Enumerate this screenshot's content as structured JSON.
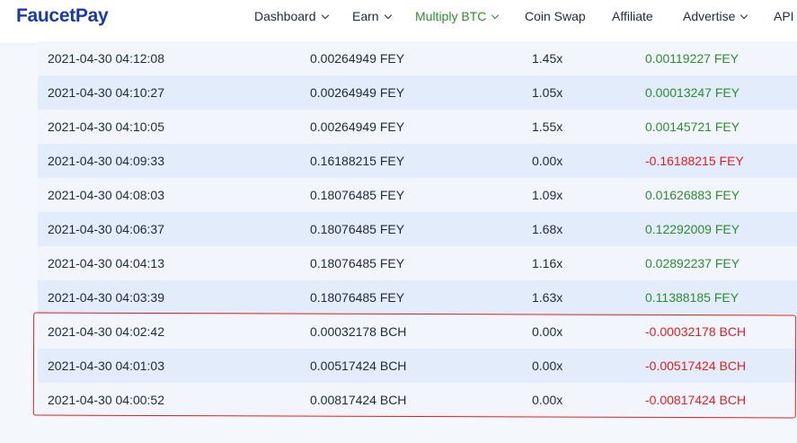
{
  "header": {
    "logo": "FaucetPay",
    "nav": [
      {
        "label": "Dashboard",
        "dropdown": true,
        "active": false
      },
      {
        "label": "Earn",
        "dropdown": true,
        "active": false
      },
      {
        "label": "Multiply BTC",
        "dropdown": true,
        "active": true
      },
      {
        "label": "Coin Swap",
        "dropdown": false,
        "active": false
      },
      {
        "label": "Affiliate",
        "dropdown": false,
        "active": false
      },
      {
        "label": "Advertise",
        "dropdown": true,
        "active": false
      },
      {
        "label": "API",
        "dropdown": false,
        "active": false
      }
    ]
  },
  "colors": {
    "brand": "#1b3aa8",
    "active_nav": "#2e8b2e",
    "profit_positive": "#2e8b2e",
    "profit_negative": "#e02020",
    "highlight_border": "#e0201e",
    "row_odd": "#f2f6fc",
    "row_even": "#e2ecfa"
  },
  "bets": [
    {
      "time": "2021-04-30 04:12:08",
      "bet": "0.00264949 FEY",
      "multiplier": "1.45x",
      "profit": "0.00119227 FEY",
      "win": true
    },
    {
      "time": "2021-04-30 04:10:27",
      "bet": "0.00264949 FEY",
      "multiplier": "1.05x",
      "profit": "0.00013247 FEY",
      "win": true
    },
    {
      "time": "2021-04-30 04:10:05",
      "bet": "0.00264949 FEY",
      "multiplier": "1.55x",
      "profit": "0.00145721 FEY",
      "win": true
    },
    {
      "time": "2021-04-30 04:09:33",
      "bet": "0.16188215 FEY",
      "multiplier": "0.00x",
      "profit": "-0.16188215 FEY",
      "win": false
    },
    {
      "time": "2021-04-30 04:08:03",
      "bet": "0.18076485 FEY",
      "multiplier": "1.09x",
      "profit": "0.01626883 FEY",
      "win": true
    },
    {
      "time": "2021-04-30 04:06:37",
      "bet": "0.18076485 FEY",
      "multiplier": "1.68x",
      "profit": "0.12292009 FEY",
      "win": true
    },
    {
      "time": "2021-04-30 04:04:13",
      "bet": "0.18076485 FEY",
      "multiplier": "1.16x",
      "profit": "0.02892237 FEY",
      "win": true
    },
    {
      "time": "2021-04-30 04:03:39",
      "bet": "0.18076485 FEY",
      "multiplier": "1.63x",
      "profit": "0.11388185 FEY",
      "win": true
    },
    {
      "time": "2021-04-30 04:02:42",
      "bet": "0.00032178 BCH",
      "multiplier": "0.00x",
      "profit": "-0.00032178 BCH",
      "win": false
    },
    {
      "time": "2021-04-30 04:01:03",
      "bet": "0.00517424 BCH",
      "multiplier": "0.00x",
      "profit": "-0.00517424 BCH",
      "win": false
    },
    {
      "time": "2021-04-30 04:00:52",
      "bet": "0.00817424 BCH",
      "multiplier": "0.00x",
      "profit": "-0.00817424 BCH",
      "win": false
    }
  ]
}
